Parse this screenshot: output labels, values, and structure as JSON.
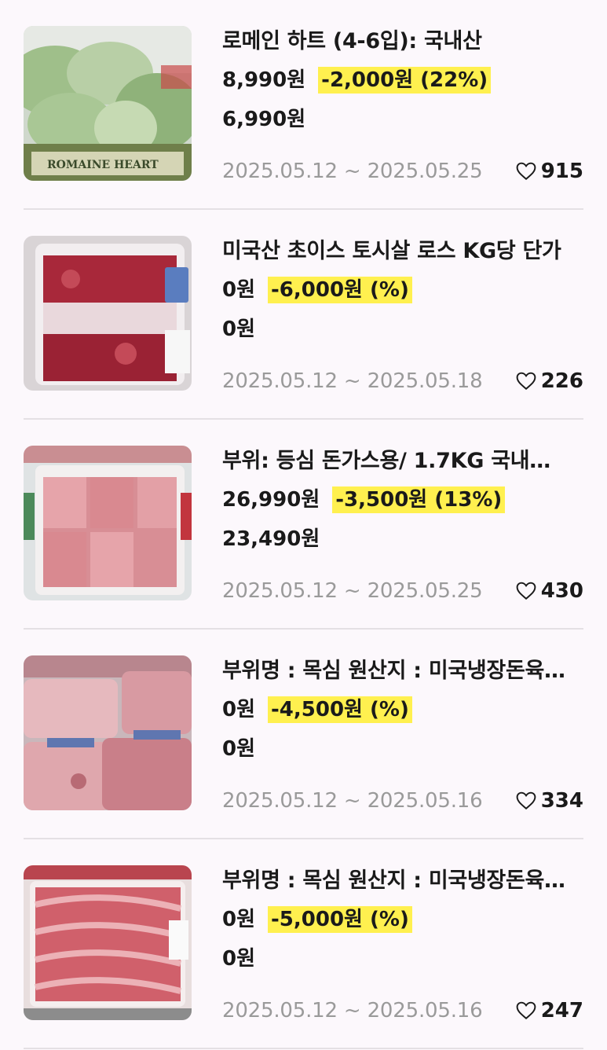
{
  "products": [
    {
      "title": "로메인 하트 (4-6입): 국내산",
      "original_price": "8,990원",
      "discount": "-2,000원 (22%)",
      "final_price": "6,990원",
      "dates": "2025.05.12 ~ 2025.05.25",
      "likes": "915",
      "image": "romaine-lettuce-photo",
      "image_label": "ROMAINE HEART"
    },
    {
      "title": "미국산 초이스 토시살 로스 KG당 단가",
      "original_price": "0원",
      "discount": "-6,000원 (%)",
      "final_price": "0원",
      "dates": "2025.05.12 ~ 2025.05.18",
      "likes": "226",
      "image": "beef-package-photo"
    },
    {
      "title": "부위: 등심 돈가스용/ 1.7KG  국내…",
      "original_price": "26,990원",
      "discount": "-3,500원 (13%)",
      "final_price": "23,490원",
      "dates": "2025.05.12 ~ 2025.05.25",
      "likes": "430",
      "image": "pork-loin-tray-photo"
    },
    {
      "title": "부위명 : 목심 원산지 : 미국냉장돈육…",
      "original_price": "0원",
      "discount": "-4,500원 (%)",
      "final_price": "0원",
      "dates": "2025.05.12 ~ 2025.05.16",
      "likes": "334",
      "image": "pork-neck-packages-photo"
    },
    {
      "title": "부위명 : 목심 원산지 : 미국냉장돈육…",
      "original_price": "0원",
      "discount": "-5,000원 (%)",
      "final_price": "0원",
      "dates": "2025.05.12 ~ 2025.05.16",
      "likes": "247",
      "image": "sliced-pork-tray-photo"
    }
  ],
  "colors": {
    "background": "#fcf8fc",
    "discount_highlight": "#fff04f",
    "date_text": "#9a9a9a",
    "divider": "#e4e0e4"
  },
  "icons": {
    "like": "heart-outline-icon"
  }
}
